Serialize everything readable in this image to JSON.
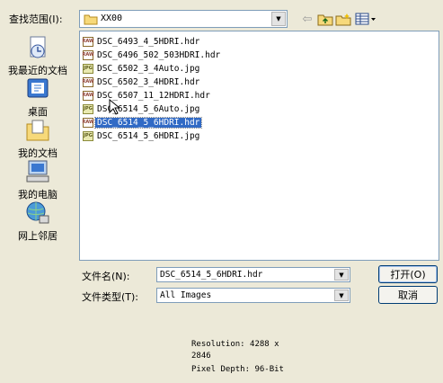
{
  "look_in": {
    "label": "查找范围(I):",
    "value": "XX00"
  },
  "places": [
    {
      "label": "我最近的文档",
      "icon": "recent-documents-icon"
    },
    {
      "label": "桌面",
      "icon": "desktop-icon"
    },
    {
      "label": "我的文档",
      "icon": "my-documents-icon"
    },
    {
      "label": "我的电脑",
      "icon": "my-computer-icon"
    },
    {
      "label": "网上邻居",
      "icon": "network-places-icon"
    }
  ],
  "files": [
    {
      "name": "DSC_6493_4_5HDRI.hdr",
      "type": "hdr"
    },
    {
      "name": "DSC_6496_502_503HDRI.hdr",
      "type": "hdr"
    },
    {
      "name": "DSC_6502_3_4Auto.jpg",
      "type": "jpg"
    },
    {
      "name": "DSC_6502_3_4HDRI.hdr",
      "type": "hdr"
    },
    {
      "name": "DSC_6507_11_12HDRI.hdr",
      "type": "hdr"
    },
    {
      "name": "DSC_6514_5_6Auto.jpg",
      "type": "jpg"
    },
    {
      "name": "DSC_6514_5_6HDRI.hdr",
      "type": "hdr",
      "selected": true
    },
    {
      "name": "DSC_6514_5_6HDRI.jpg",
      "type": "jpg"
    }
  ],
  "file_icon_text": {
    "hdr": "RAW",
    "jpg": "JPG"
  },
  "filename": {
    "label": "文件名(N):",
    "value": "DSC_6514_5_6HDRI.hdr"
  },
  "filetype": {
    "label": "文件类型(T):",
    "value": "All Images"
  },
  "buttons": {
    "open": "打开(O)",
    "cancel": "取消"
  },
  "preview": {
    "resolution_line1": "Resolution: 4288 x",
    "resolution_line2": "2846",
    "pixel_depth": "Pixel Depth: 96-Bit"
  },
  "colors": {
    "selection": "#316ac5",
    "dialog_bg": "#ece9d8",
    "field_border": "#7f9db9"
  }
}
